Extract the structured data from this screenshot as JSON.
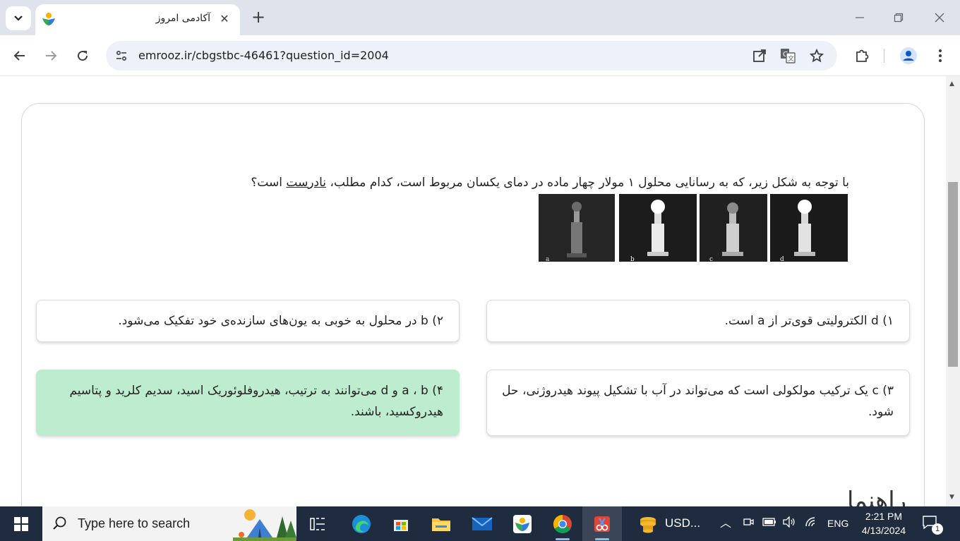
{
  "browser": {
    "tab_title": "آکادمی امروز",
    "url": "emrooz.ir/cbgstbc-46461?question_id=2004"
  },
  "question": {
    "text_before": "با توجه به شکل زیر، که به رسانایی محلول ۱ مولار چهار ماده در دمای یکسان مربوط است، کدام مطلب، ",
    "underlined": "نادرست",
    "text_after": " است؟",
    "figure_labels": [
      "a",
      "b",
      "c",
      "d"
    ]
  },
  "options": [
    {
      "text": "۱) d الکترولیتی قوی‌تر از a است.",
      "correct": false
    },
    {
      "text": "۲) b در محلول به خوبی به یون‌های سازنده‌ی خود تفکیک می‌شود.",
      "correct": false
    },
    {
      "text": "۳) c یک ترکیب مولکولی است که می‌تواند در آب با تشکیل پیوند هیدروژنی، حل شود.",
      "correct": false
    },
    {
      "text": "۴)  a ، b و d می‌توانند به ترتیب، هیدروفلوئوریک اسید، سدیم کلرید و پتاسیم هیدروکسید، باشند.",
      "correct": true
    }
  ],
  "next_section_heading": "راهنما",
  "taskbar": {
    "search_placeholder": "Type here to search",
    "usd_app_label": "USD...",
    "language": "ENG",
    "time": "2:21 PM",
    "date": "4/13/2024",
    "notification_count": "1"
  },
  "colors": {
    "correct_option_bg": "#bdeccf",
    "taskbar_bg": "#1f2b3f",
    "tabstrip_bg": "#dfe3eb",
    "omnibox_bg": "#edf1f9"
  }
}
